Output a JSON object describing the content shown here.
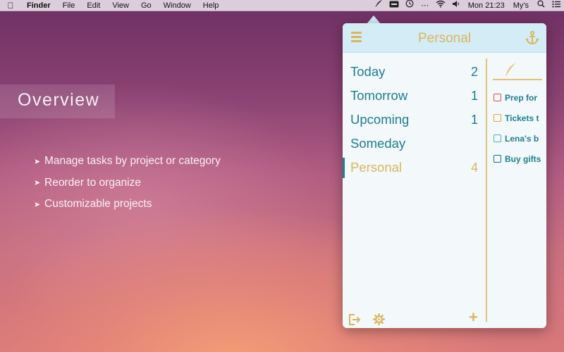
{
  "menubar": {
    "apple_icon": "apple-icon",
    "items": [
      "Finder",
      "File",
      "Edit",
      "View",
      "Go",
      "Window",
      "Help"
    ],
    "status": {
      "clock": "Mon 21:23",
      "user": "My's"
    },
    "status_icons": [
      "quill-icon",
      "keyboard-icon",
      "time-machine-icon",
      "bluetooth-icon",
      "wifi-icon",
      "volume-icon",
      "spotlight-icon",
      "notification-center-icon"
    ]
  },
  "slide": {
    "title": "Overview",
    "bullets": [
      "Manage tasks by project or category",
      "Reorder to organize",
      "Customizable projects"
    ]
  },
  "popover": {
    "title": "Personal",
    "categories": [
      {
        "label": "Today",
        "count": "2"
      },
      {
        "label": "Tomorrow",
        "count": "1"
      },
      {
        "label": "Upcoming",
        "count": "1"
      },
      {
        "label": "Someday",
        "count": ""
      },
      {
        "label": "Personal",
        "count": "4"
      }
    ],
    "tasks": [
      {
        "text": "Prep for",
        "color": "#e04848"
      },
      {
        "text": "Tickets t",
        "color": "#d9a640"
      },
      {
        "text": "Lena's b",
        "color": "#4ab0c4"
      },
      {
        "text": "Buy gifts",
        "color": "#1d6e84"
      }
    ],
    "accent": "#d9b65c",
    "teal": "#1d7e90",
    "header_bg": "#d4ecf6"
  }
}
